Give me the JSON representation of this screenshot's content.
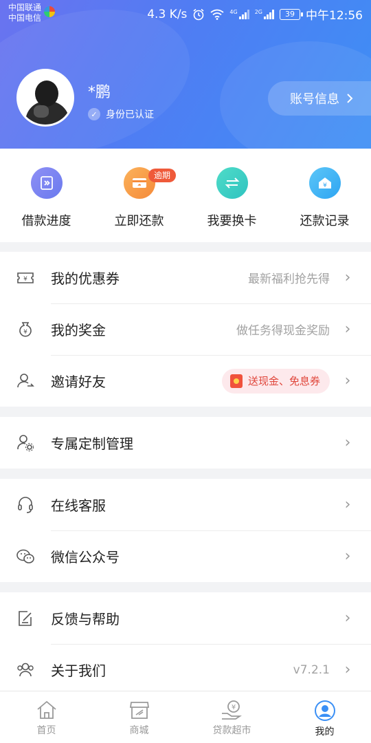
{
  "status_bar": {
    "carrier_1": "中国联通",
    "carrier_2": "中国电信",
    "speed": "4.3 K/s",
    "net_1": "4G",
    "net_2": "2G",
    "battery": "39",
    "time": "中午12:56"
  },
  "profile": {
    "name": "*鹏",
    "verified_text": "身份已认证",
    "account_button": "账号信息"
  },
  "quick_actions": [
    {
      "label": "借款进度",
      "icon": "loan-progress-icon",
      "color": "#7b84f2"
    },
    {
      "label": "立即还款",
      "icon": "repay-card-icon",
      "color": "#f8a24a",
      "badge": "逾期"
    },
    {
      "label": "我要换卡",
      "icon": "swap-card-icon",
      "color": "#3fd0c2"
    },
    {
      "label": "还款记录",
      "icon": "repayment-record-icon",
      "color": "#3fb4f5"
    }
  ],
  "menu": {
    "coupons": {
      "label": "我的优惠券",
      "hint": "最新福利抢先得"
    },
    "bonus": {
      "label": "我的奖金",
      "hint": "做任务得现金奖励"
    },
    "invite": {
      "label": "邀请好友",
      "promo": "送现金、免息券"
    },
    "custom": {
      "label": "专属定制管理"
    },
    "service": {
      "label": "在线客服"
    },
    "wechat": {
      "label": "微信公众号"
    },
    "feedback": {
      "label": "反馈与帮助"
    },
    "about": {
      "label": "关于我们",
      "version": "v7.2.1"
    }
  },
  "tabs": [
    {
      "label": "首页",
      "icon": "home-icon"
    },
    {
      "label": "商城",
      "icon": "store-icon"
    },
    {
      "label": "贷款超市",
      "icon": "loan-market-icon"
    },
    {
      "label": "我的",
      "icon": "profile-icon",
      "active": true
    }
  ],
  "colors": {
    "header_start": "#6a73f0",
    "header_end": "#3e8ff5",
    "overdue_badge": "#ef5a3a",
    "promo_text": "#e0453a",
    "active_tab": "#3a8ff5"
  }
}
